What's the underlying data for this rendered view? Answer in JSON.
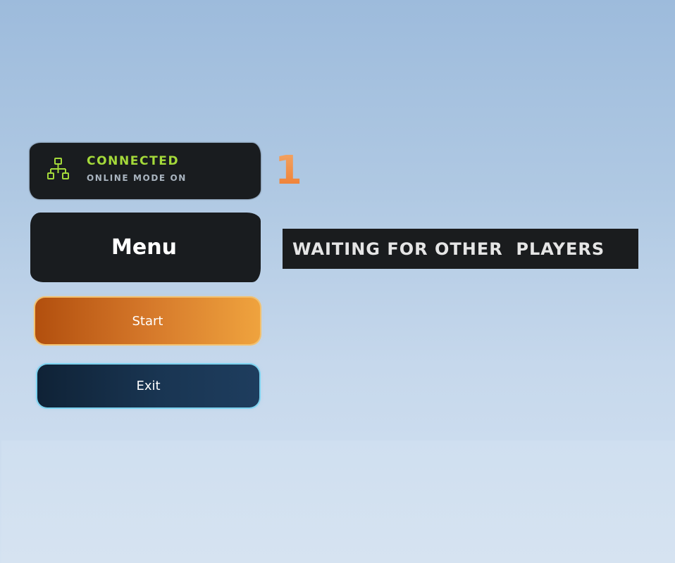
{
  "status": {
    "icon": "network-icon",
    "title": "CONNECTED",
    "subtitle": "ONLINE MODE ON",
    "color": "#a4d93a"
  },
  "player_count": "1",
  "menu": {
    "title": "Menu",
    "start_label": "Start",
    "exit_label": "Exit"
  },
  "waiting_message": "WAITING FOR OTHER  PLAYERS",
  "colors": {
    "panel_bg": "#191c1f",
    "accent_orange": "#ef7a2d",
    "exit_blue": "#193552",
    "exit_border": "#7dd3f0"
  }
}
